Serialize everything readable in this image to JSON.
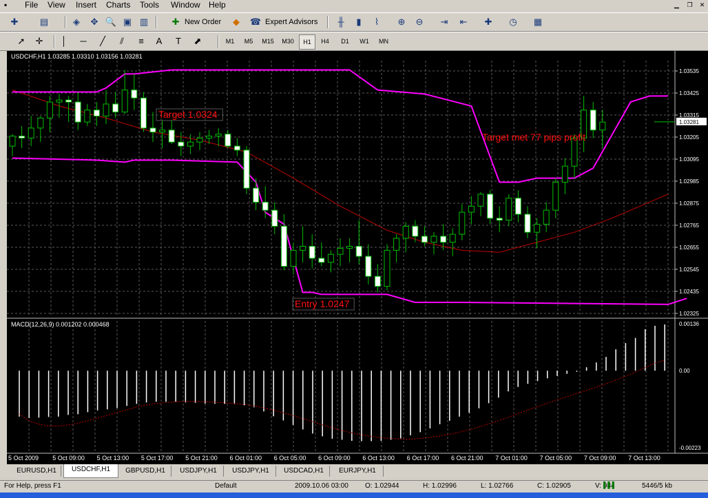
{
  "menu": [
    "File",
    "View",
    "Insert",
    "Charts",
    "Tools",
    "Window",
    "Help"
  ],
  "toolbar1": {
    "new_order": "New Order",
    "expert_advisors": "Expert Advisors"
  },
  "timeframes": [
    "M1",
    "M5",
    "M15",
    "M30",
    "H1",
    "H4",
    "D1",
    "W1",
    "MN"
  ],
  "active_timeframe": "H1",
  "chart": {
    "title": "USDCHF,H1  1.03285 1.03310 1.03156 1.03281",
    "price_labels": [
      "1.03535",
      "1.03425",
      "1.03315",
      "1.03205",
      "1.03095",
      "1.02985",
      "1.02875",
      "1.02765",
      "1.02655",
      "1.02545",
      "1.02435",
      "1.02325"
    ],
    "current_price": "1.03281",
    "annotations": {
      "target": "Target 1.0324",
      "target_met": "Target met 77 pips profit",
      "entry": "Entry 1.0247"
    },
    "macd_title": "MACD(12,26,9) 0.001202 0.000468",
    "macd_labels": [
      "0.00136",
      "0.00",
      "-0.00223"
    ],
    "time_labels": [
      "5 Oct 2009",
      "5 Oct 09:00",
      "5 Oct 13:00",
      "5 Oct 17:00",
      "5 Oct 21:00",
      "6 Oct 01:00",
      "6 Oct 05:00",
      "6 Oct 09:00",
      "6 Oct 13:00",
      "6 Oct 17:00",
      "6 Oct 21:00",
      "7 Oct 01:00",
      "7 Oct 05:00",
      "7 Oct 09:00",
      "7 Oct 13:00"
    ],
    "colors": {
      "bull": "#ffffff",
      "bear": "#ffffff",
      "wick": "#00c000",
      "channel": "#ff00ff",
      "ma": "#c00000",
      "grid": "#5a5a5a"
    },
    "candles": [
      [
        1.0316,
        1.0322,
        1.0311,
        1.0321
      ],
      [
        1.0321,
        1.0326,
        1.0315,
        1.032
      ],
      [
        1.032,
        1.0331,
        1.0316,
        1.0325
      ],
      [
        1.0325,
        1.0331,
        1.0318,
        1.033
      ],
      [
        1.033,
        1.0341,
        1.0323,
        1.0338
      ],
      [
        1.0338,
        1.0342,
        1.033,
        1.0339
      ],
      [
        1.0339,
        1.0341,
        1.0328,
        1.0338
      ],
      [
        1.0338,
        1.0343,
        1.0324,
        1.0328
      ],
      [
        1.0328,
        1.0337,
        1.0326,
        1.0334
      ],
      [
        1.0334,
        1.0338,
        1.0326,
        1.0331
      ],
      [
        1.0331,
        1.0344,
        1.0327,
        1.0337
      ],
      [
        1.0337,
        1.0343,
        1.033,
        1.0333
      ],
      [
        1.0333,
        1.0354,
        1.0332,
        1.0344
      ],
      [
        1.0344,
        1.0352,
        1.0334,
        1.034
      ],
      [
        1.034,
        1.0343,
        1.0323,
        1.0325
      ],
      [
        1.0325,
        1.0333,
        1.0318,
        1.0323
      ],
      [
        1.0323,
        1.0329,
        1.0315,
        1.0324
      ],
      [
        1.0324,
        1.0329,
        1.0317,
        1.0318
      ],
      [
        1.0318,
        1.0323,
        1.0311,
        1.0316
      ],
      [
        1.0316,
        1.0322,
        1.0312,
        1.0318
      ],
      [
        1.0318,
        1.0323,
        1.0314,
        1.032
      ],
      [
        1.032,
        1.0324,
        1.0317,
        1.0321
      ],
      [
        1.0321,
        1.0325,
        1.0316,
        1.0322
      ],
      [
        1.0322,
        1.0324,
        1.0315,
        1.0316
      ],
      [
        1.0316,
        1.032,
        1.0311,
        1.0314
      ],
      [
        1.0314,
        1.0316,
        1.0292,
        1.0295
      ],
      [
        1.0295,
        1.03,
        1.0284,
        1.0288
      ],
      [
        1.0288,
        1.0296,
        1.028,
        1.0284
      ],
      [
        1.0284,
        1.0288,
        1.0272,
        1.0276
      ],
      [
        1.0276,
        1.0282,
        1.0254,
        1.0256
      ],
      [
        1.0256,
        1.0268,
        1.0252,
        1.0264
      ],
      [
        1.0264,
        1.0276,
        1.0258,
        1.0266
      ],
      [
        1.0266,
        1.0272,
        1.0255,
        1.026
      ],
      [
        1.026,
        1.0268,
        1.0256,
        1.0258
      ],
      [
        1.0258,
        1.0264,
        1.0253,
        1.0262
      ],
      [
        1.0262,
        1.027,
        1.0256,
        1.0265
      ],
      [
        1.0265,
        1.027,
        1.0258,
        1.0266
      ],
      [
        1.0266,
        1.0279,
        1.0257,
        1.0261
      ],
      [
        1.0261,
        1.0267,
        1.0247,
        1.0251
      ],
      [
        1.0251,
        1.0257,
        1.0243,
        1.0246
      ],
      [
        1.0246,
        1.0267,
        1.0244,
        1.0264
      ],
      [
        1.0264,
        1.0272,
        1.0258,
        1.027
      ],
      [
        1.027,
        1.0278,
        1.0263,
        1.0276
      ],
      [
        1.0276,
        1.0279,
        1.0268,
        1.0271
      ],
      [
        1.0271,
        1.0276,
        1.0266,
        1.0268
      ],
      [
        1.0268,
        1.0273,
        1.0262,
        1.0271
      ],
      [
        1.0271,
        1.0277,
        1.0264,
        1.0268
      ],
      [
        1.0268,
        1.0275,
        1.0261,
        1.0272
      ],
      [
        1.0272,
        1.0287,
        1.0269,
        1.0283
      ],
      [
        1.0283,
        1.0291,
        1.0277,
        1.0286
      ],
      [
        1.0286,
        1.0293,
        1.0281,
        1.0292
      ],
      [
        1.0292,
        1.0294,
        1.0277,
        1.028
      ],
      [
        1.028,
        1.0286,
        1.0273,
        1.0279
      ],
      [
        1.0279,
        1.0292,
        1.0276,
        1.029
      ],
      [
        1.029,
        1.0294,
        1.0278,
        1.0282
      ],
      [
        1.0282,
        1.0286,
        1.027,
        1.0273
      ],
      [
        1.0273,
        1.028,
        1.0265,
        1.0277
      ],
      [
        1.0277,
        1.0288,
        1.0273,
        1.0284
      ],
      [
        1.0284,
        1.03,
        1.028,
        1.0298
      ],
      [
        1.0298,
        1.031,
        1.0292,
        1.0306
      ],
      [
        1.0306,
        1.0322,
        1.03,
        1.032
      ],
      [
        1.032,
        1.0341,
        1.0313,
        1.0334
      ],
      [
        1.0334,
        1.0338,
        1.032,
        1.0324
      ],
      [
        1.0324,
        1.0334,
        1.0315,
        1.0328
      ]
    ],
    "upper_band": [
      [
        0,
        1.0343
      ],
      [
        9,
        1.0343
      ],
      [
        10,
        1.0345
      ],
      [
        12,
        1.0352
      ],
      [
        13,
        1.0352
      ],
      [
        17,
        1.0354
      ],
      [
        36,
        1.0354
      ],
      [
        39,
        1.0344
      ],
      [
        44,
        1.0342
      ],
      [
        49,
        1.0336
      ],
      [
        52,
        1.0298
      ],
      [
        54,
        1.0298
      ],
      [
        56,
        1.03
      ],
      [
        60,
        1.03
      ],
      [
        62,
        1.0305
      ],
      [
        66,
        1.0338
      ],
      [
        68,
        1.0341
      ],
      [
        70,
        1.0341
      ]
    ],
    "lower_band": [
      [
        0,
        1.031
      ],
      [
        9,
        1.0309
      ],
      [
        12,
        1.0308
      ],
      [
        13,
        1.0309
      ],
      [
        17,
        1.0309
      ],
      [
        24,
        1.0308
      ],
      [
        26,
        1.0298
      ],
      [
        27,
        1.0283
      ],
      [
        29,
        1.0277
      ],
      [
        31,
        1.0243
      ],
      [
        32,
        1.0243
      ],
      [
        33,
        1.0242
      ],
      [
        40,
        1.0242
      ],
      [
        43,
        1.0238
      ],
      [
        48,
        1.0238
      ],
      [
        70,
        1.0237
      ],
      [
        72,
        1.024
      ]
    ],
    "ma": [
      [
        0,
        1.0344
      ],
      [
        5,
        1.0336
      ],
      [
        10,
        1.033
      ],
      [
        15,
        1.0323
      ],
      [
        20,
        1.0319
      ],
      [
        25,
        1.0313
      ],
      [
        30,
        1.03
      ],
      [
        35,
        1.0286
      ],
      [
        40,
        1.0274
      ],
      [
        44,
        1.0268
      ],
      [
        48,
        1.0264
      ],
      [
        52,
        1.0263
      ],
      [
        56,
        1.0268
      ],
      [
        60,
        1.0273
      ],
      [
        64,
        1.028
      ],
      [
        68,
        1.0288
      ],
      [
        70,
        1.0292
      ]
    ],
    "macd": [
      -0.00133,
      -0.00137,
      -0.00136,
      -0.00134,
      -0.00133,
      -0.00128,
      -0.00126,
      -0.0012,
      -0.00115,
      -0.00112,
      -0.00108,
      -0.00102,
      -0.00096,
      -0.00092,
      -0.0009,
      -0.0009,
      -0.0009,
      -0.00092,
      -0.00093,
      -0.00095,
      -0.00096,
      -0.00096,
      -0.00097,
      -0.001,
      -0.00106,
      -0.00118,
      -0.00132,
      -0.00144,
      -0.00157,
      -0.0017,
      -0.00182,
      -0.0019,
      -0.00197,
      -0.002,
      -0.00203,
      -0.00204,
      -0.00204,
      -0.00203,
      -0.002,
      -0.00196,
      -0.00187,
      -0.00178,
      -0.00167,
      -0.00155,
      -0.00145,
      -0.00133,
      -0.00122,
      -0.00109,
      -0.00094,
      -0.00078,
      -0.0006,
      -0.00047,
      -0.00038,
      -0.0003,
      -0.00022,
      -0.00015,
      -9e-05,
      -3e-05,
      0.0001,
      0.00024,
      0.0004,
      0.00062,
      0.0008,
      0.00095,
      0.0012,
      0.0013,
      0.00134
    ],
    "macd_signal": [
      -0.00125,
      -0.00145,
      -0.00155,
      -0.0016,
      -0.0016,
      -0.00157,
      -0.00152,
      -0.00145,
      -0.00137,
      -0.00129,
      -0.00121,
      -0.00113,
      -0.00105,
      -0.00099,
      -0.00095,
      -0.00092,
      -0.0009,
      -0.00089,
      -0.00089,
      -0.0009,
      -0.00091,
      -0.00093,
      -0.00095,
      -0.00098,
      -0.00102,
      -0.00108,
      -0.00114,
      -0.00122,
      -0.0013,
      -0.00139,
      -0.00148,
      -0.00157,
      -0.00165,
      -0.00173,
      -0.0018,
      -0.00186,
      -0.0019,
      -0.00194,
      -0.00196,
      -0.00198,
      -0.00198,
      -0.00196,
      -0.00193,
      -0.00189,
      -0.00184,
      -0.00178,
      -0.00171,
      -0.00163,
      -0.00154,
      -0.00145,
      -0.00135,
      -0.00124,
      -0.00114,
      -0.00104,
      -0.00094,
      -0.00084,
      -0.00075,
      -0.00066,
      -0.00057,
      -0.00048,
      -0.00038,
      -0.00027,
      -0.00016,
      -4e-05,
      9e-05,
      0.00022,
      0.0003
    ]
  },
  "tabs": [
    "EURUSD,H1",
    "USDCHF,H1",
    "GBPUSD,H1",
    "USDJPY,H1",
    "USDJPY,H1",
    "USDCAD,H1",
    "EURJPY,H1"
  ],
  "active_tab": 1,
  "status": {
    "help": "For Help, press F1",
    "profile": "Default",
    "time": "2009.10.06 03:00",
    "open": "O: 1.02944",
    "high": "H: 1.02996",
    "low": "L: 1.02766",
    "close": "C: 1.02905",
    "volume": "V: 984",
    "traffic": "5446/5 kb"
  }
}
